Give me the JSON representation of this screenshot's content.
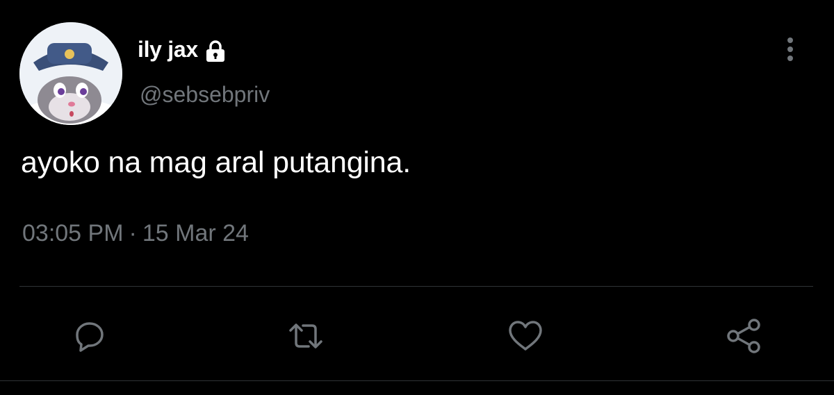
{
  "user": {
    "display_name": "ily jax",
    "handle": "@sebsebpriv",
    "protected_icon": "lock-icon",
    "avatar_icon": "cartoon-bunny-avatar"
  },
  "tweet": {
    "text": "ayoko na mag aral putangina.",
    "time": "03:05 PM",
    "separator": "·",
    "date": "15 Mar 24"
  },
  "actions": [
    {
      "name": "reply",
      "icon": "reply-icon"
    },
    {
      "name": "retweet",
      "icon": "retweet-icon"
    },
    {
      "name": "like",
      "icon": "heart-icon"
    },
    {
      "name": "share",
      "icon": "share-icon"
    }
  ],
  "colors": {
    "background": "#000000",
    "primary_text": "#ffffff",
    "secondary_text": "#71767b",
    "divider": "#2f3336"
  }
}
